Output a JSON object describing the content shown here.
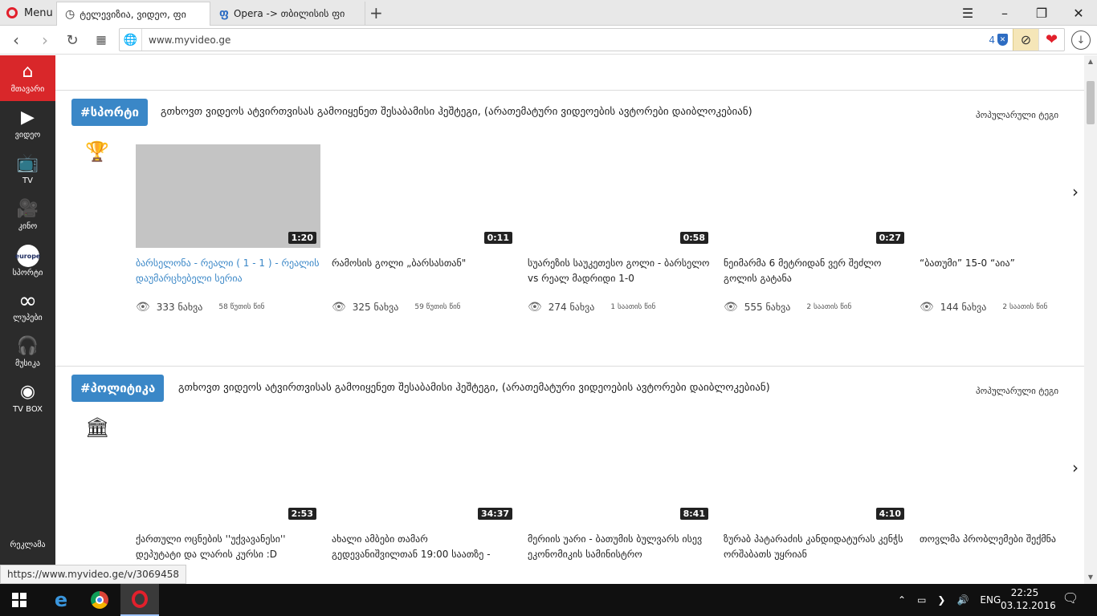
{
  "browser": {
    "menu_label": "Menu",
    "tabs": [
      {
        "title": "ტელევიზია, ვიდეო, ფი"
      },
      {
        "title": "Opera -> თბილისის ფი"
      }
    ],
    "new_tab": "+",
    "window_controls": {
      "minimize": "–",
      "restore": "❐",
      "close": "✕"
    },
    "url": "www.myvideo.ge",
    "blocked_count": "4",
    "status_url": "https://www.myvideo.ge/v/3069458"
  },
  "sidebar": {
    "items": [
      {
        "label": "მთავარი",
        "icon": "home-icon"
      },
      {
        "label": "ვიდეო",
        "icon": "play-icon"
      },
      {
        "label": "TV",
        "icon": "tv-icon"
      },
      {
        "label": "კინო",
        "icon": "camera-icon"
      },
      {
        "label": "სპორტი",
        "icon": "eurosport-logo",
        "logo_text": "europe"
      },
      {
        "label": "ლუპები",
        "icon": "infinity-icon"
      },
      {
        "label": "მუსიკა",
        "icon": "headphones-icon"
      },
      {
        "label": "TV BOX",
        "icon": "tvbox-icon"
      }
    ],
    "ad_label": "რეკლამა"
  },
  "sections": [
    {
      "tag": "#სპორტი",
      "note": "გთხოვთ ვიდეოს ატვირთვისას გამოიყენეთ შესაბამისი ჰეშტეგი, (არათემატური ვიდეოების ავტორები დაიბლოკებიან)",
      "popular_tags": "პოპულარული ტეგი",
      "icon": "trophy-icon",
      "videos": [
        {
          "duration": "1:20",
          "title": "ბარსელონა - რეალი ( 1 - 1 ) - რეალის დაუმარცხებელი სერია",
          "views": "333 ნახვა",
          "ago": "58 წუთის წინ"
        },
        {
          "duration": "0:11",
          "title": "რამოსის გოლი „ბარსასთან\"",
          "views": "325 ნახვა",
          "ago": "59 წუთის წინ"
        },
        {
          "duration": "0:58",
          "title": "სუარეზის საუკეთესო გოლი - ბარსელო vs რეალ მადრიდი 1-0",
          "views": "274 ნახვა",
          "ago": "1 საათის წინ"
        },
        {
          "duration": "0:27",
          "title": "ნეიმარმა 6 მეტრიდან ვერ შეძლო გოლის გატანა",
          "views": "555 ნახვა",
          "ago": "2 საათის წინ"
        },
        {
          "duration": "",
          "title": "“ბათუმი” 15-0 “აია”",
          "views": "144 ნახვა",
          "ago": "2 საათის წინ"
        }
      ]
    },
    {
      "tag": "#პოლიტიკა",
      "note": "გთხოვთ ვიდეოს ატვირთვისას გამოიყენეთ შესაბამისი ჰეშტეგი, (არათემატური ვიდეოების ავტორები დაიბლოკებიან)",
      "popular_tags": "პოპულარული ტეგი",
      "icon": "capitol-icon",
      "videos": [
        {
          "duration": "2:53",
          "title": "ქართული ოცნების ''უქვავანესი'' დეპუტატი და ლარის კურსი :D"
        },
        {
          "duration": "34:37",
          "title": "ახალი ამბები თამარ გედევანიშვილთან 19:00 საათზე -"
        },
        {
          "duration": "8:41",
          "title": "მერიის უარი - ბათუმის ბულვარს ისევ ეკონომიკის სამინისტრო"
        },
        {
          "duration": "4:10",
          "title": "ზურაბ პატარაძის კანდიდატურას კენჭს ორშაბათს უყრიან"
        },
        {
          "duration": "",
          "title": "თოვლმა პრობლემები შექმნა"
        }
      ]
    }
  ],
  "taskbar": {
    "language": "ENG",
    "time": "22:25",
    "date": "03.12.2016"
  }
}
